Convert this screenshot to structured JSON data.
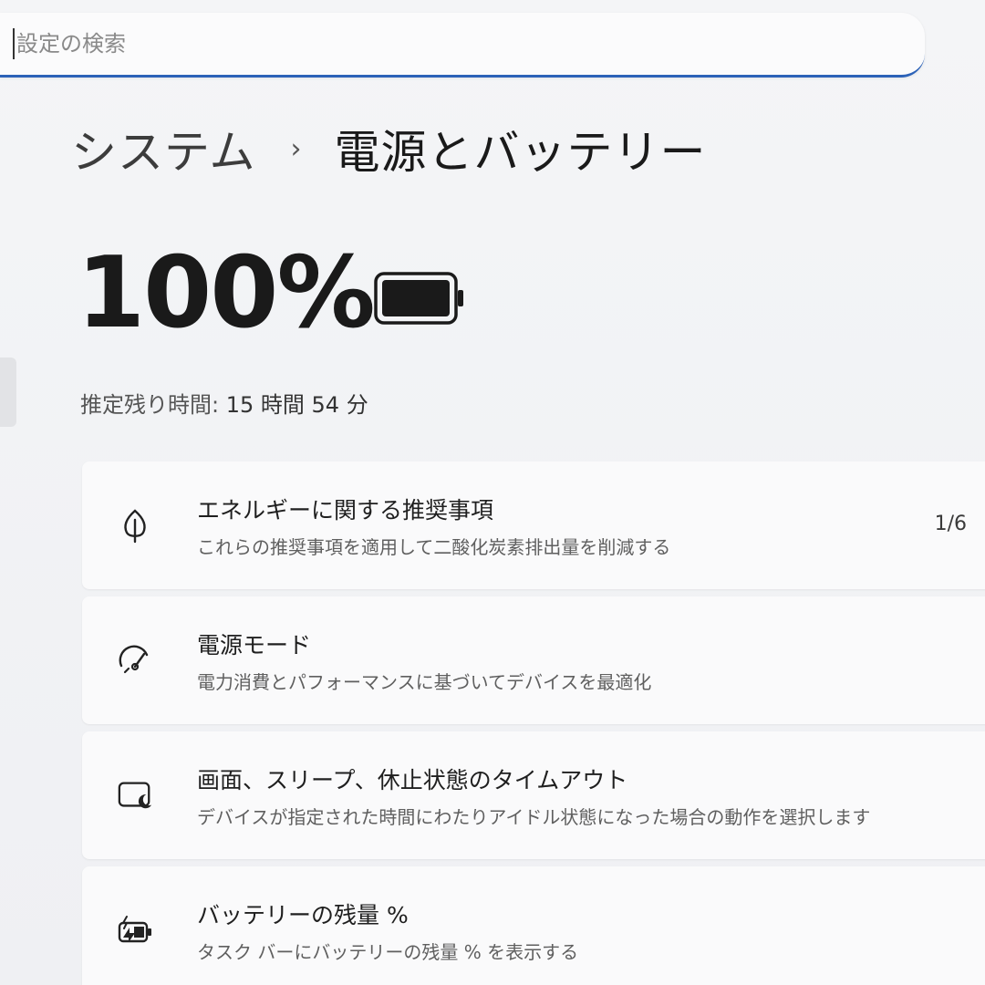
{
  "search": {
    "placeholder": "設定の検索"
  },
  "breadcrumb": {
    "parent": "システム",
    "separator": "›",
    "current": "電源とバッテリー"
  },
  "battery": {
    "percent": "100%",
    "remaining_label": "推定残り時間:",
    "remaining_value": "15 時間 54 分",
    "level": 1.0
  },
  "cards": [
    {
      "icon": "leaf-icon",
      "title": "エネルギーに関する推奨事項",
      "subtitle": "これらの推奨事項を適用して二酸化炭素排出量を削減する",
      "value": "1/6"
    },
    {
      "icon": "power-mode-icon",
      "title": "電源モード",
      "subtitle": "電力消費とパフォーマンスに基づいてデバイスを最適化"
    },
    {
      "icon": "screen-sleep-icon",
      "title": "画面、スリープ、休止状態のタイムアウト",
      "subtitle": "デバイスが指定された時間にわたりアイドル状態になった場合の動作を選択します"
    },
    {
      "icon": "battery-charging-icon",
      "title": "バッテリーの残量 %",
      "subtitle": "タスク バーにバッテリーの残量 % を表示する"
    }
  ],
  "colors": {
    "accent": "#2c62b8",
    "text": "#1a1a1a"
  }
}
